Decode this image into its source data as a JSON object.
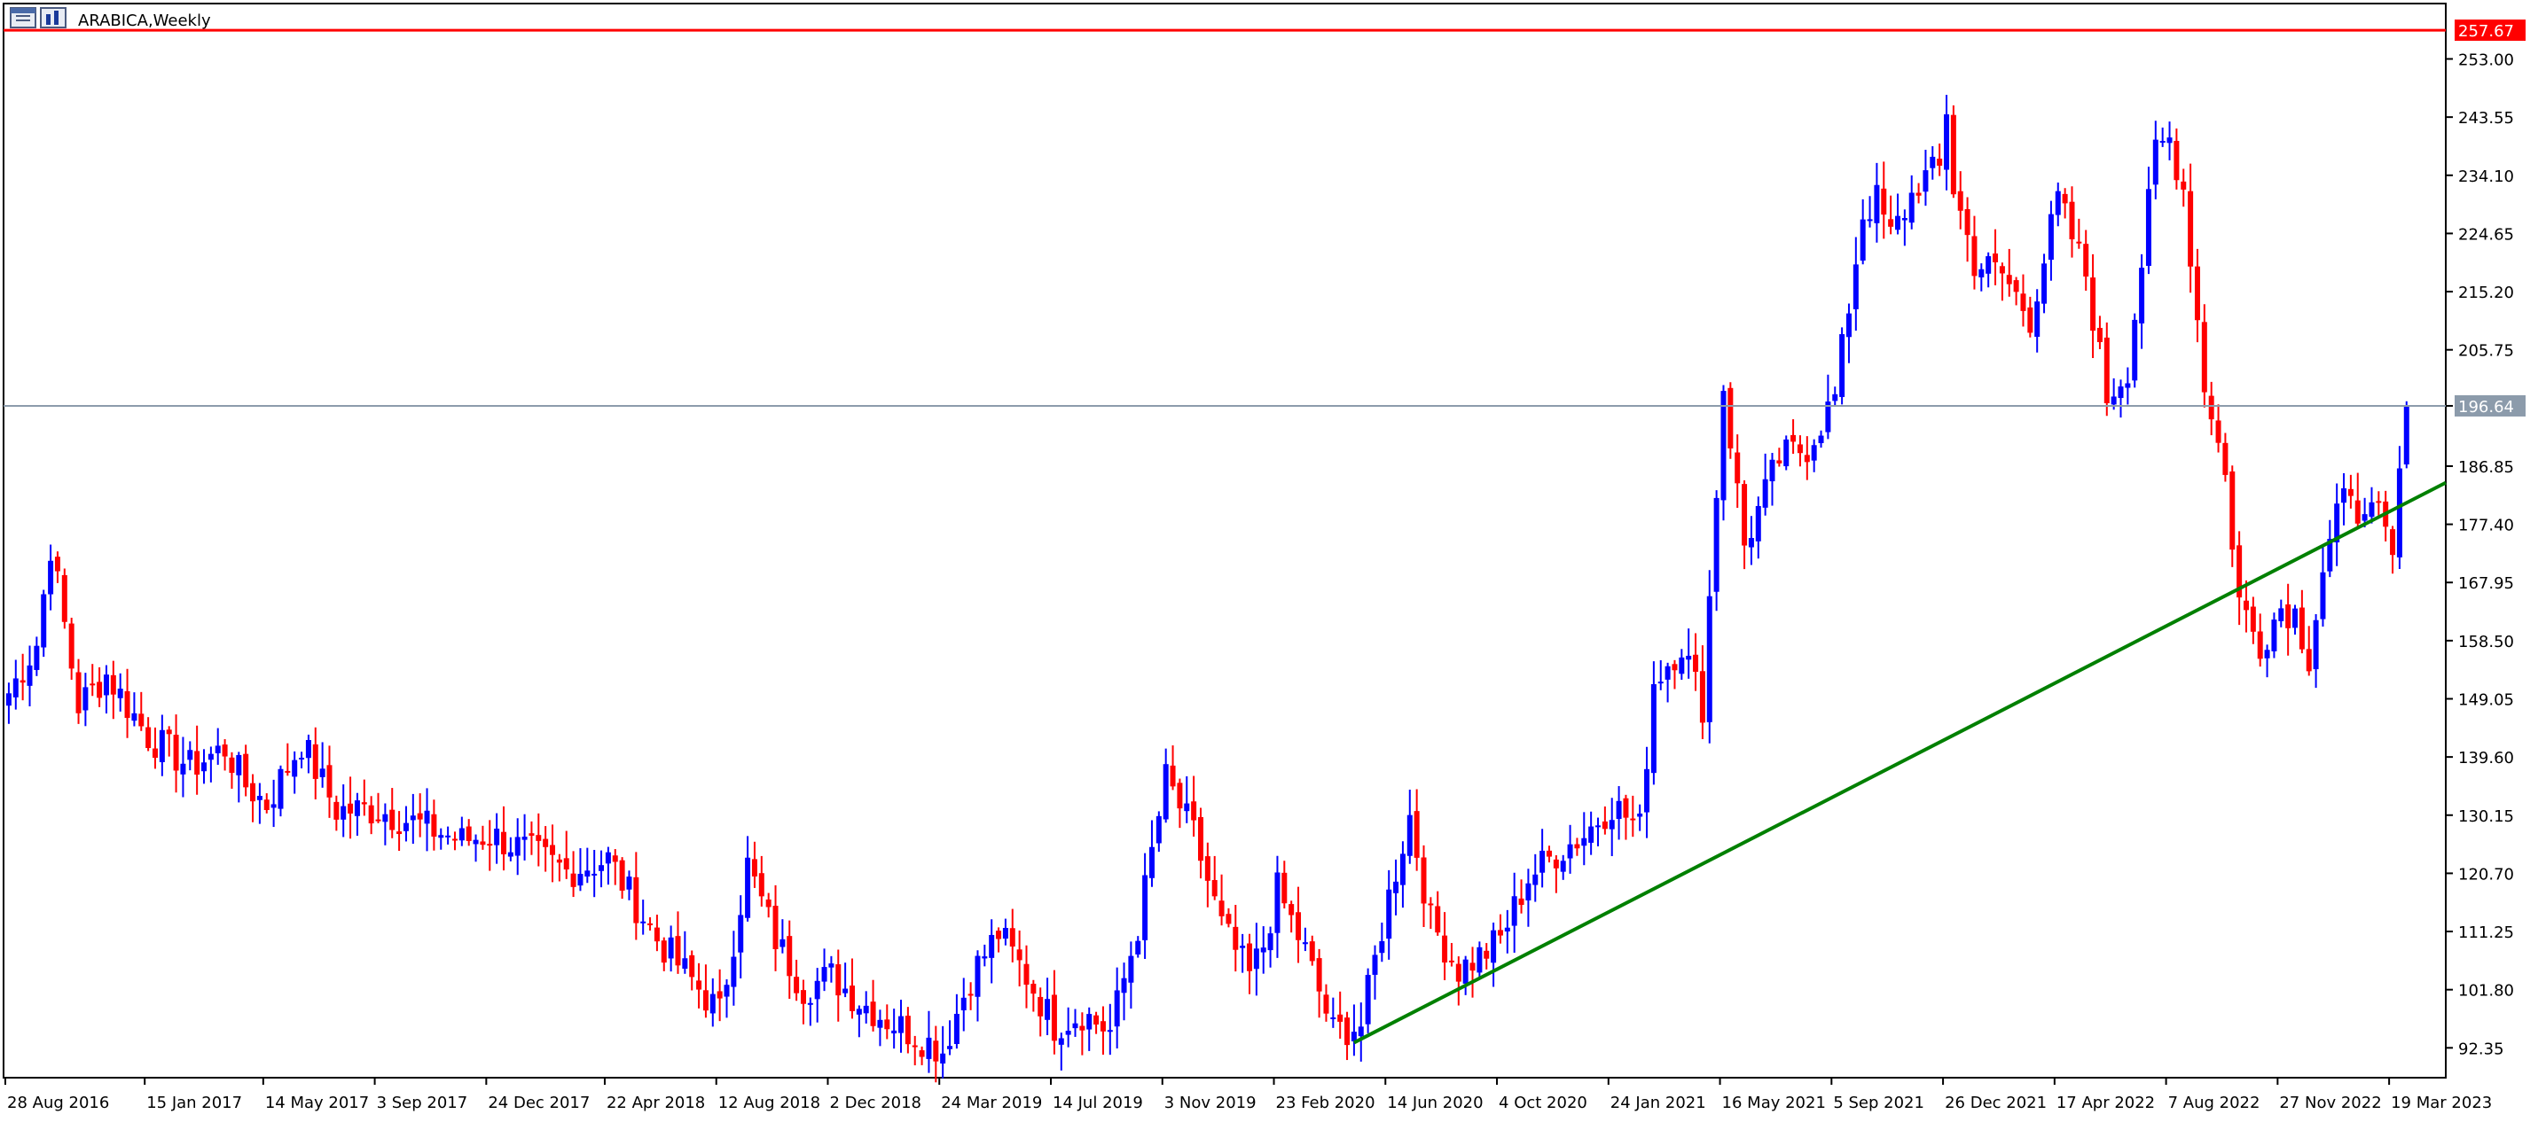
{
  "window": {
    "title": "ARABICA,Weekly",
    "icon": "chart-window-icon"
  },
  "chart_data": {
    "type": "candlestick",
    "symbol": "ARABICA",
    "timeframe": "Weekly",
    "xlabel": "",
    "ylabel": "",
    "ylim": [
      87.5,
      262.0
    ],
    "y_ticks": [
      "253.00",
      "243.55",
      "234.10",
      "224.65",
      "215.20",
      "205.75",
      "196.64",
      "186.85",
      "177.40",
      "167.95",
      "158.50",
      "149.05",
      "139.60",
      "130.15",
      "120.70",
      "111.25",
      "101.80",
      "92.35"
    ],
    "x_ticks": [
      "28 Aug 2016",
      "15 Jan 2017",
      "14 May 2017",
      "3 Sep 2017",
      "24 Dec 2017",
      "22 Apr 2018",
      "12 Aug 2018",
      "2 Dec 2018",
      "24 Mar 2019",
      "14 Jul 2019",
      "3 Nov 2019",
      "23 Feb 2020",
      "14 Jun 2020",
      "4 Oct 2020",
      "24 Jan 2021",
      "16 May 2021",
      "5 Sep 2021",
      "26 Dec 2021",
      "17 Apr 2022",
      "7 Aug 2022",
      "27 Nov 2022",
      "19 Mar 2023"
    ],
    "x_tick_index": [
      0,
      20,
      37,
      53,
      69,
      86,
      102,
      118,
      134,
      150,
      166,
      182,
      198,
      214,
      230,
      246,
      262,
      278,
      294,
      310,
      326,
      342
    ],
    "grid": false,
    "colors": {
      "up": "#0000ff",
      "down": "#ff0000",
      "background": "#ffffff",
      "axis": "#000000",
      "trendline": "#008000",
      "resistance": "#ff0000",
      "current_price_line": "#8c9bab"
    },
    "waypoints": [
      [
        0,
        150
      ],
      [
        4,
        158
      ],
      [
        6,
        174
      ],
      [
        10,
        148
      ],
      [
        14,
        153
      ],
      [
        20,
        143
      ],
      [
        26,
        138
      ],
      [
        31,
        141
      ],
      [
        34,
        135
      ],
      [
        37,
        132
      ],
      [
        42,
        142
      ],
      [
        47,
        131
      ],
      [
        53,
        131
      ],
      [
        58,
        129
      ],
      [
        65,
        126
      ],
      [
        69,
        127
      ],
      [
        75,
        124
      ],
      [
        80,
        121
      ],
      [
        86,
        123
      ],
      [
        93,
        110
      ],
      [
        99,
        102
      ],
      [
        102,
        98
      ],
      [
        106,
        122
      ],
      [
        110,
        110
      ],
      [
        114,
        102
      ],
      [
        118,
        104
      ],
      [
        122,
        100
      ],
      [
        126,
        97
      ],
      [
        134,
        92
      ],
      [
        138,
        104
      ],
      [
        142,
        111
      ],
      [
        146,
        104
      ],
      [
        150,
        96
      ],
      [
        154,
        98
      ],
      [
        158,
        95
      ],
      [
        162,
        112
      ],
      [
        166,
        136
      ],
      [
        170,
        127
      ],
      [
        174,
        112
      ],
      [
        178,
        104
      ],
      [
        180,
        109
      ],
      [
        182,
        118
      ],
      [
        186,
        108
      ],
      [
        190,
        95
      ],
      [
        194,
        96
      ],
      [
        198,
        117
      ],
      [
        201,
        130
      ],
      [
        204,
        113
      ],
      [
        208,
        105
      ],
      [
        212,
        108
      ],
      [
        214,
        110
      ],
      [
        218,
        120
      ],
      [
        222,
        124
      ],
      [
        226,
        127
      ],
      [
        230,
        132
      ],
      [
        234,
        128
      ],
      [
        236,
        152
      ],
      [
        240,
        158
      ],
      [
        243,
        148
      ],
      [
        245,
        183
      ],
      [
        246,
        200
      ],
      [
        249,
        174
      ],
      [
        254,
        188
      ],
      [
        258,
        190
      ],
      [
        262,
        198
      ],
      [
        266,
        228
      ],
      [
        268,
        230
      ],
      [
        270,
        224
      ],
      [
        274,
        233
      ],
      [
        277,
        235
      ],
      [
        278,
        245
      ],
      [
        279,
        232
      ],
      [
        282,
        220
      ],
      [
        286,
        218
      ],
      [
        290,
        211
      ],
      [
        294,
        230
      ],
      [
        298,
        218
      ],
      [
        301,
        198
      ],
      [
        304,
        203
      ],
      [
        306,
        220
      ],
      [
        308,
        238
      ],
      [
        310,
        240
      ],
      [
        312,
        232
      ],
      [
        315,
        200
      ],
      [
        316,
        196
      ],
      [
        318,
        185
      ],
      [
        320,
        165
      ],
      [
        322,
        160
      ],
      [
        323,
        158
      ],
      [
        326,
        164
      ],
      [
        328,
        163
      ],
      [
        330,
        156
      ],
      [
        332,
        170
      ],
      [
        334,
        178
      ],
      [
        336,
        184
      ],
      [
        338,
        177
      ],
      [
        340,
        179
      ],
      [
        342,
        172
      ],
      [
        344,
        196
      ]
    ],
    "series": [
      {
        "name": "",
        "kind": "trendline",
        "points": [
          [
            193,
            93.2
          ],
          [
            349,
            183.8
          ]
        ]
      }
    ],
    "annotations": {
      "resistance_label": "257.67",
      "resistance_value": 257.67,
      "current_price_label": "196.64",
      "current_price_value": 196.64
    }
  }
}
